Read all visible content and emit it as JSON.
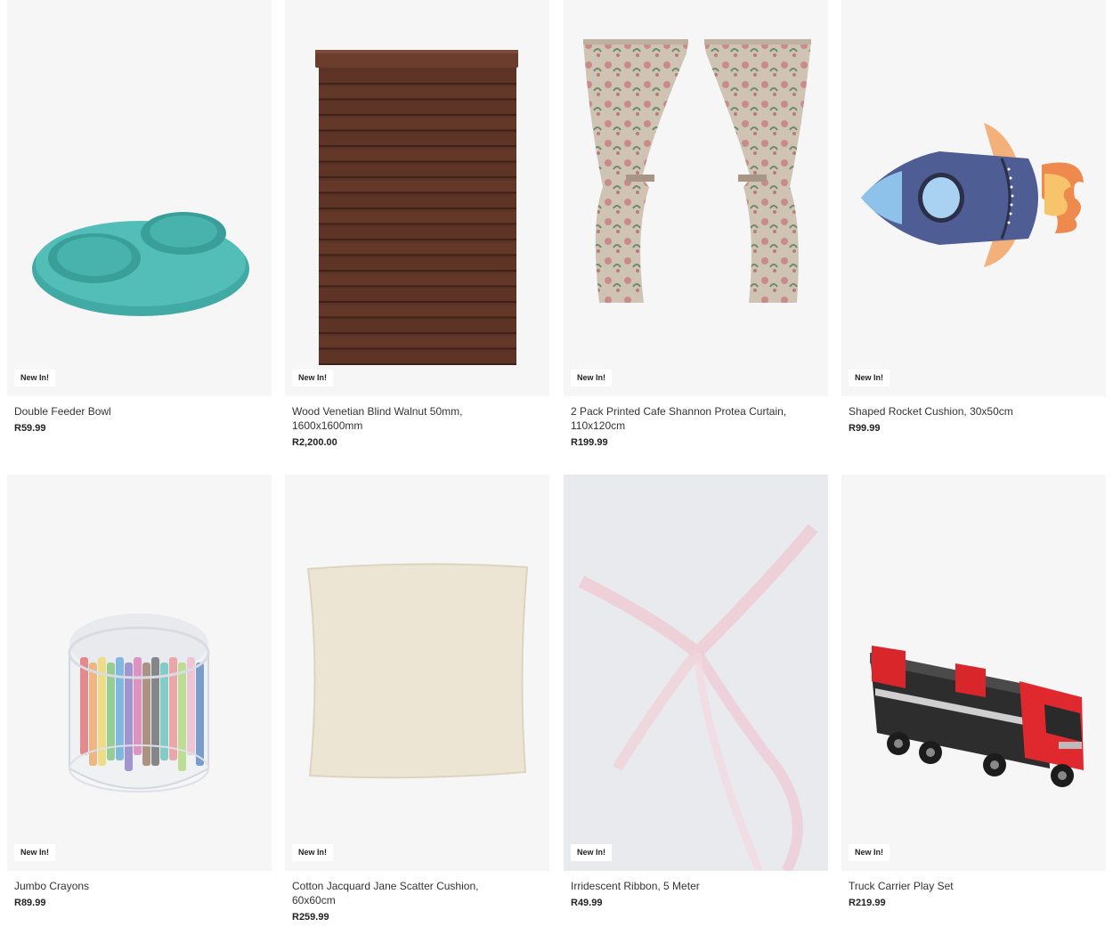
{
  "products": [
    {
      "name": "Double Feeder Bowl",
      "price": "R59.99",
      "badge": "New In!",
      "icon": "double-feeder-bowl-image"
    },
    {
      "name": "Wood Venetian Blind Walnut 50mm, 1600x1600mm",
      "price": "R2,200.00",
      "badge": "New In!",
      "icon": "venetian-blind-image"
    },
    {
      "name": "2 Pack Printed Cafe Shannon Protea Curtain, 110x120cm",
      "price": "R199.99",
      "badge": "New In!",
      "icon": "curtain-image"
    },
    {
      "name": "Shaped Rocket Cushion, 30x50cm",
      "price": "R99.99",
      "badge": "New In!",
      "icon": "rocket-cushion-image"
    },
    {
      "name": "Jumbo Crayons",
      "price": "R89.99",
      "badge": "New In!",
      "icon": "crayons-tub-image"
    },
    {
      "name": "Cotton Jacquard Jane Scatter Cushion, 60x60cm",
      "price": "R259.99",
      "badge": "New In!",
      "icon": "scatter-cushion-image"
    },
    {
      "name": "Irridescent Ribbon, 5 Meter",
      "price": "R49.99",
      "badge": "New In!",
      "icon": "ribbon-image"
    },
    {
      "name": "Truck Carrier Play Set",
      "price": "R219.99",
      "badge": "New In!",
      "icon": "truck-toy-image"
    }
  ]
}
